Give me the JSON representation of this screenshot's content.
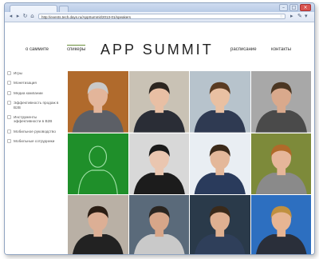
{
  "browser": {
    "url": "http://events.tech.days.ru/AppSummit/2013-01/speakers",
    "controls": [
      "–",
      "□",
      "×"
    ]
  },
  "site": {
    "logo": "APP SUMMIT",
    "nav": [
      {
        "label": "о саммите"
      },
      {
        "label": "спикеры"
      },
      {
        "label": "расписание"
      },
      {
        "label": "контакты"
      }
    ]
  },
  "sidebar": {
    "items": [
      {
        "label": "Игры"
      },
      {
        "label": "Монетизация"
      },
      {
        "label": "Медиа кампании"
      },
      {
        "label": "Эффективность продаж в B2B"
      },
      {
        "label": "Инструменты эффективности в B2B"
      },
      {
        "label": "Мобильное руководство"
      },
      {
        "label": "Мобильные сотрудники"
      }
    ]
  },
  "speakers": [
    {
      "bg": "#b06a2c",
      "shirt": "#5c5f66",
      "skin": "#e3b59a",
      "hair": "#c9c9c9"
    },
    {
      "bg": "#c9c2b5",
      "shirt": "#2a2d36",
      "skin": "#e8bfa4",
      "hair": "#2b2520"
    },
    {
      "bg": "#b7c3cc",
      "shirt": "#2f3a52",
      "skin": "#e9c0a2",
      "hair": "#5a3b22"
    },
    {
      "bg": "#a8a8a8",
      "shirt": "#4a4a4a",
      "skin": "#d9a98c",
      "hair": "#4b3622"
    },
    {
      "bg": "#1f8f2a",
      "placeholder": true
    },
    {
      "bg": "#d8d8d8",
      "shirt": "#1c1c1c",
      "skin": "#eac6b0",
      "hair": "#1a1a1a"
    },
    {
      "bg": "#e9eef3",
      "shirt": "#2a3b5c",
      "skin": "#e4b89a",
      "hair": "#3b2a1a"
    },
    {
      "bg": "#7d8a3a",
      "shirt": "#8a8a8a",
      "skin": "#e6b69a",
      "hair": "#b06a2a"
    },
    {
      "bg": "#b9b0a5",
      "shirt": "#222222",
      "skin": "#dcaf95",
      "hair": "#2a1d14"
    },
    {
      "bg": "#5a6a7a",
      "shirt": "#c9c9c9",
      "skin": "#d7a689",
      "hair": "#2a2520"
    },
    {
      "bg": "#2a3a4a",
      "shirt": "#2f3f5a",
      "skin": "#dfb091",
      "hair": "#3a2a1a"
    },
    {
      "bg": "#2d6fc0",
      "shirt": "#2a2f3a",
      "skin": "#e7b593",
      "hair": "#c09040"
    }
  ]
}
